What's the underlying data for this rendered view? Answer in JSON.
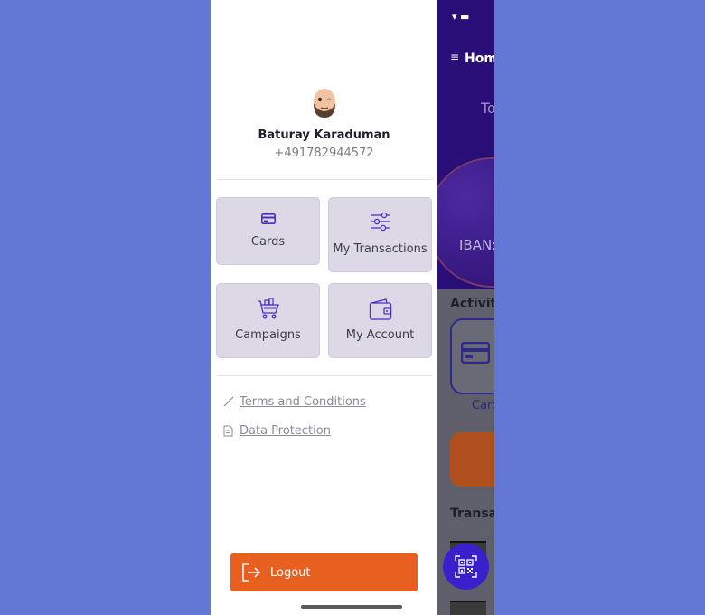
{
  "profile": {
    "name": "Baturay Karaduman",
    "phone": "+491782944572"
  },
  "menu": {
    "tiles": [
      {
        "label": "Cards",
        "icon": "card-icon"
      },
      {
        "label": "My Transactions",
        "icon": "sliders-icon"
      },
      {
        "label": "Campaigns",
        "icon": "shopping-cart-icon"
      },
      {
        "label": "My Account",
        "icon": "wallet-icon"
      }
    ]
  },
  "links": {
    "terms": "Terms and Conditions",
    "privacy": "Data Protection"
  },
  "logout_label": "Logout",
  "background_app": {
    "home": "Home",
    "total": "To",
    "iban": "IBAN:",
    "activities": "Activitie",
    "card": "Card",
    "transactions": "Transac"
  },
  "colors": {
    "page_bg": "#6277d4",
    "tile_bg": "#dcd8e6",
    "accent": "#e8601f",
    "icon": "#4a2fc7",
    "header": "#2a0e78"
  }
}
